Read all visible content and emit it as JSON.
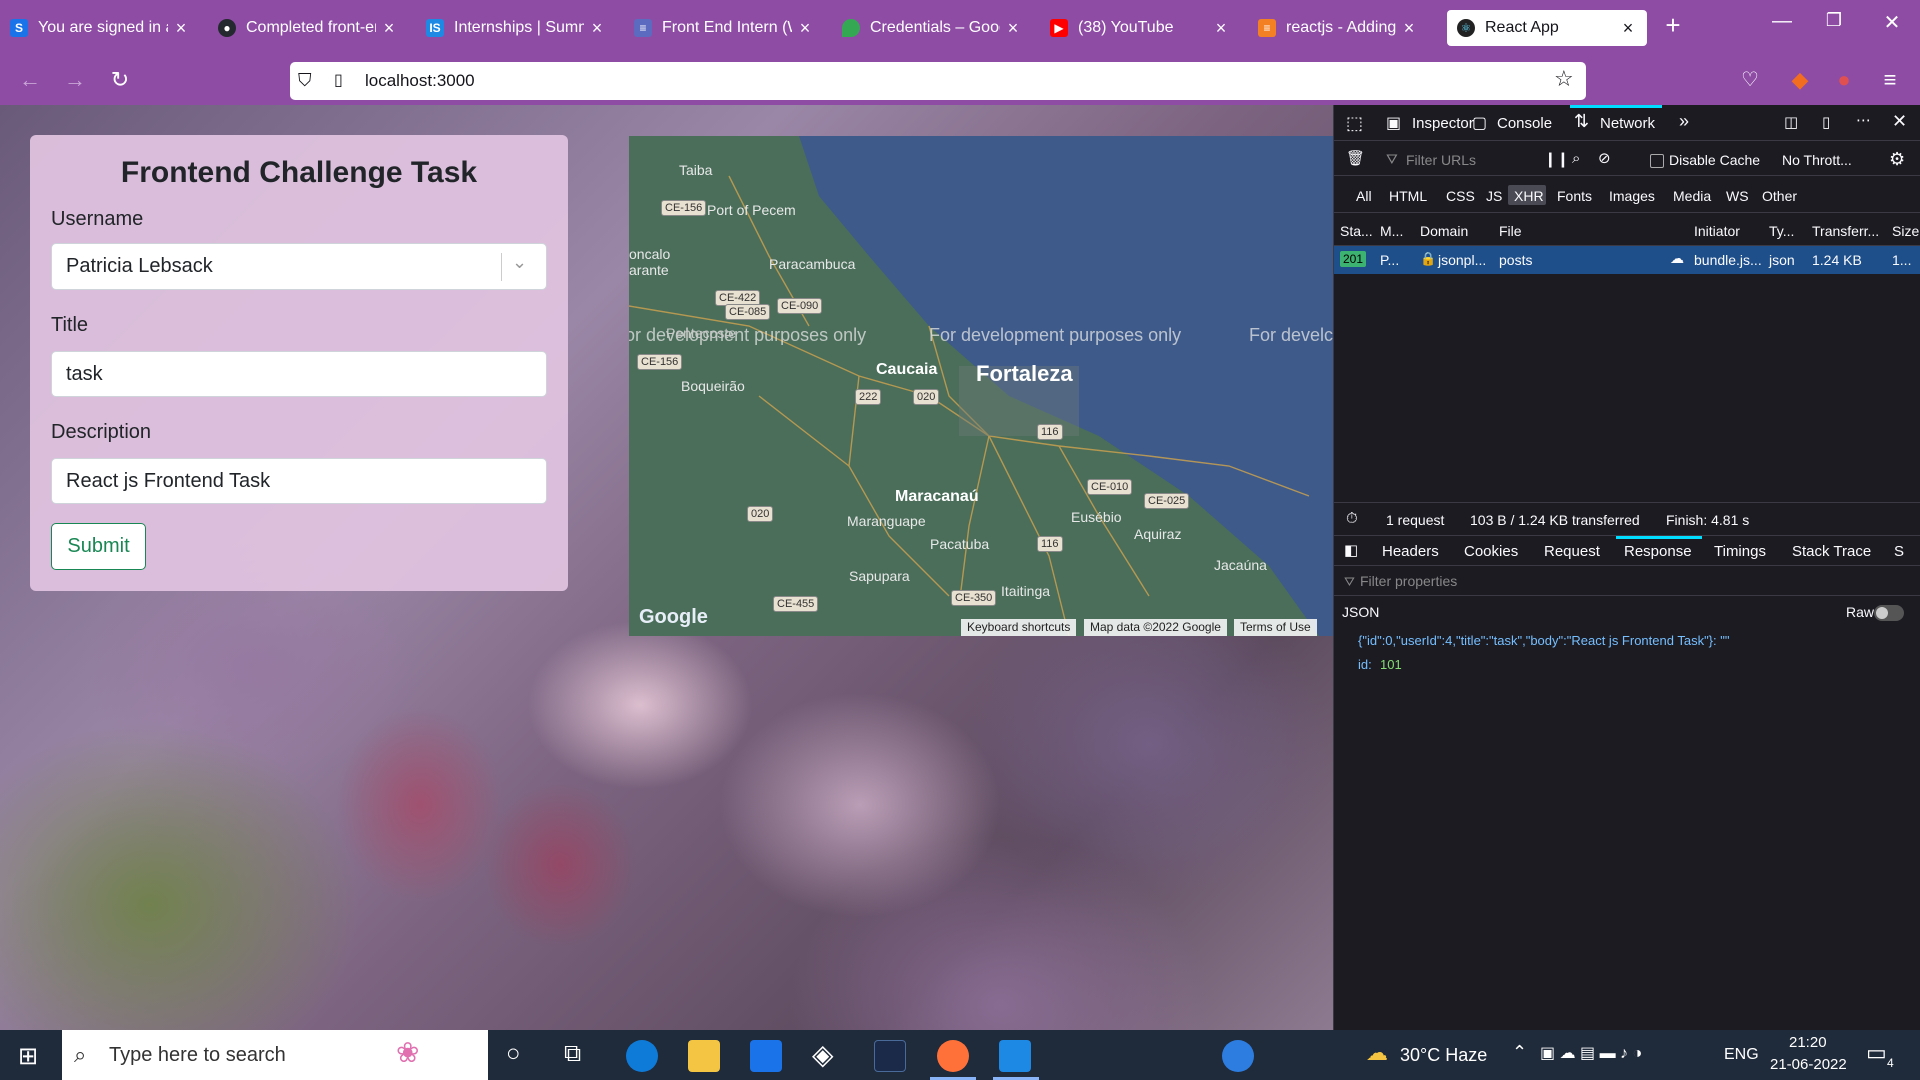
{
  "browser": {
    "tabs": [
      {
        "label": "You are signed in as",
        "icon": "s-icon",
        "color": "#1a73e8"
      },
      {
        "label": "Completed front-en",
        "icon": "github-icon",
        "color": "#24292f"
      },
      {
        "label": "Internships | Summe",
        "icon": "is-icon",
        "color": "#1e88e5"
      },
      {
        "label": "Front End Intern (W",
        "icon": "list-icon",
        "color": "#5c6bc0"
      },
      {
        "label": "Credentials – Googl",
        "icon": "maps-pin-icon",
        "color": "#34a853"
      },
      {
        "label": "(38) YouTube",
        "icon": "youtube-icon",
        "color": "#ff0000"
      },
      {
        "label": "reactjs - Adding an",
        "icon": "stackoverflow-icon",
        "color": "#f48024"
      },
      {
        "label": "React App",
        "icon": "react-icon",
        "color": "#61dafb"
      }
    ],
    "new_tab": "+",
    "url": "localhost:3000"
  },
  "form": {
    "title": "Frontend Challenge Task",
    "username_label": "Username",
    "username_value": "Patricia Lebsack",
    "title_label": "Title",
    "title_value": "task",
    "description_label": "Description",
    "description_value": "React js Frontend Task",
    "submit_label": "Submit"
  },
  "map": {
    "watermark": [
      "or development purposes only",
      "For development purposes only",
      "For develc"
    ],
    "cities": {
      "fortaleza": "Fortaleza",
      "caucaia": "Caucaia",
      "maracanau": "Maracanaú"
    },
    "places": [
      "Taiba",
      "Port of Pecem",
      "Paracambuca",
      "Boqueirão",
      "Maranguape",
      "Pacatuba",
      "Eusébio",
      "Aquiraz",
      "Jacaúna",
      "Sapupara",
      "Itaitinga",
      "Pentecoste",
      "oncalo",
      "arante"
    ],
    "roads": [
      "CE-156",
      "CE-422",
      "CE-085",
      "CE-090",
      "222",
      "020",
      "116",
      "CE-010",
      "CE-025",
      "CE-350",
      "CE-455",
      "CE-156",
      "020",
      "116"
    ],
    "logo": "Google",
    "footer": {
      "shortcuts": "Keyboard shortcuts",
      "data": "Map data ©2022 Google",
      "terms": "Terms of Use"
    }
  },
  "devtools": {
    "tools": {
      "inspector": "Inspector",
      "console": "Console",
      "network": "Network"
    },
    "filter_placeholder": "Filter URLs",
    "disable_cache": "Disable Cache",
    "throttle": "No Thrott...",
    "types": [
      "All",
      "HTML",
      "CSS",
      "JS",
      "XHR",
      "Fonts",
      "Images",
      "Media",
      "WS",
      "Other"
    ],
    "columns": [
      "Sta...",
      "M...",
      "Domain",
      "File",
      "Initiator",
      "Ty...",
      "Transferr...",
      "Size"
    ],
    "request": {
      "status": "201",
      "method": "P...",
      "domain": "jsonpl...",
      "file": "posts",
      "initiator": "bundle.js...",
      "type": "json",
      "transferred": "1.24 KB",
      "size": "1..."
    },
    "summary": {
      "requests": "1 request",
      "transferred": "103 B / 1.24 KB transferred",
      "finish": "Finish: 4.81 s"
    },
    "detail_tabs": [
      "Headers",
      "Cookies",
      "Request",
      "Response",
      "Timings",
      "Stack Trace",
      "S"
    ],
    "filter_props": "Filter properties",
    "json_label": "JSON",
    "raw_label": "Raw",
    "response_line": "{\"id\":0,\"userId\":4,\"title\":\"task\",\"body\":\"React js Frontend Task\"}: \"\"",
    "id_key": "id:",
    "id_value": "101"
  },
  "taskbar": {
    "search_placeholder": "Type here to search",
    "weather": "30°C  Haze",
    "lang": "ENG",
    "time": "21:20",
    "date": "21-06-2022",
    "notifications": "4"
  }
}
